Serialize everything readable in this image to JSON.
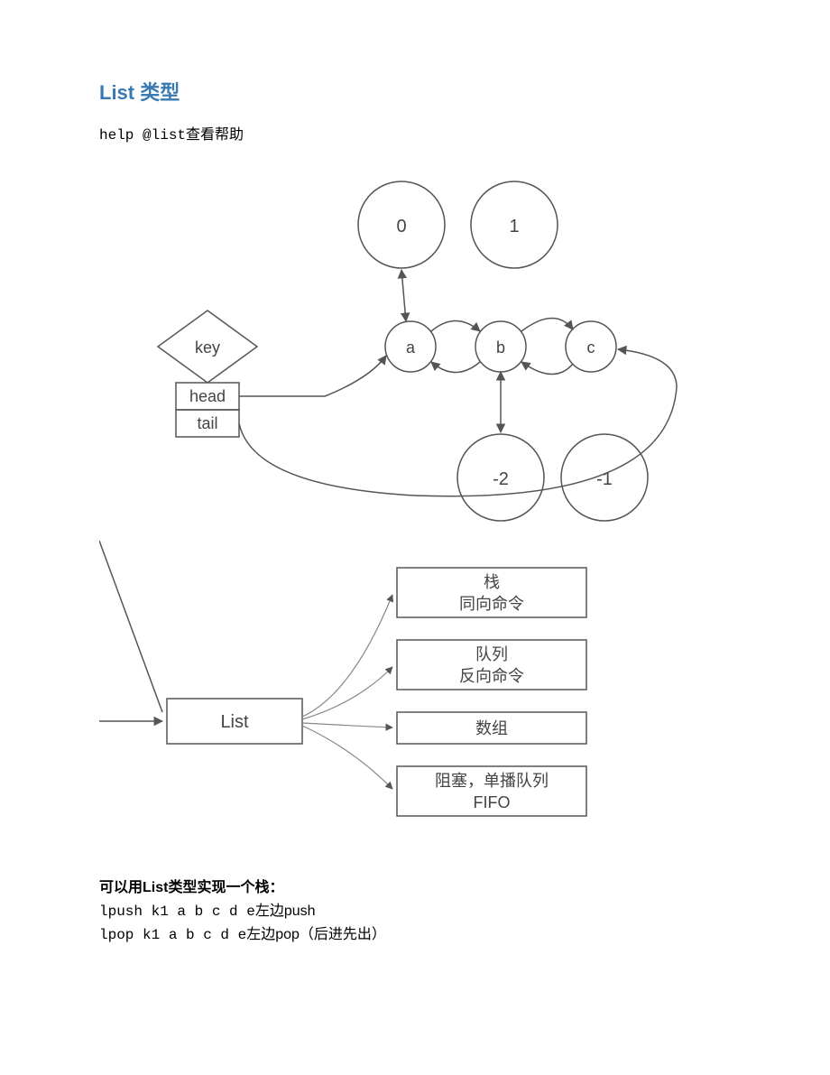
{
  "title": "List 类型",
  "help_prefix": "help @list",
  "help_suffix": "查看帮助",
  "diagram1": {
    "key": "key",
    "head": "head",
    "tail": "tail",
    "nodes": {
      "a": "a",
      "b": "b",
      "c": "c"
    },
    "indices": {
      "i0": "0",
      "i1": "1",
      "n2": "-2",
      "n1": "-1"
    }
  },
  "diagram2": {
    "center": "List",
    "boxes": {
      "stack_l1": "栈",
      "stack_l2": "同向命令",
      "queue_l1": "队列",
      "queue_l2": "反向命令",
      "array": "数组",
      "fifo_l1": "阻塞，单播队列",
      "fifo_l2": "FIFO"
    }
  },
  "stack_section": {
    "heading": "可以用List类型实现一个栈：",
    "line1_cmd": "lpush k1 a b c d e",
    "line1_txt": "左边push",
    "line2_cmd": "lpop k1 a b c d e",
    "line2_txt": "左边pop（后进先出）"
  }
}
